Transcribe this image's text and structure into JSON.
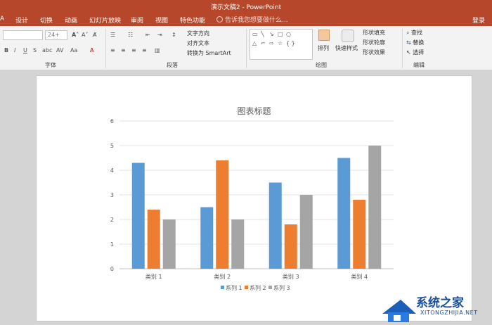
{
  "window": {
    "title": "演示文稿2 - PowerPoint",
    "left_glyph": "A",
    "login_label": "登录"
  },
  "tabs": [
    {
      "label": "设计"
    },
    {
      "label": "切换"
    },
    {
      "label": "动画"
    },
    {
      "label": "幻灯片放映"
    },
    {
      "label": "审阅"
    },
    {
      "label": "视图"
    },
    {
      "label": "特色功能"
    }
  ],
  "tell_me": {
    "placeholder": "告诉我您想要做什么..."
  },
  "ribbon": {
    "font_group_label": "字体",
    "font_size": "24+",
    "paragraph_group_label": "段落",
    "text_direction": "文字方向",
    "align_text": "对齐文本",
    "convert_smartart": "转换为 SmartArt",
    "drawing_group_label": "绘图",
    "arrange_label": "排列",
    "quick_styles_label": "快速样式",
    "shape_fill": "形状填充",
    "shape_outline": "形状轮廓",
    "shape_effects": "形状效果",
    "editing_group_label": "编辑",
    "find": "查找",
    "replace": "替换",
    "select": "选择"
  },
  "watermark": {
    "name": "系统之家",
    "url": "XITONGZHIJIA.NET"
  },
  "chart_data": {
    "type": "bar",
    "title": "图表标题",
    "categories": [
      "类别 1",
      "类别 2",
      "类别 3",
      "类别 4"
    ],
    "series": [
      {
        "name": "系列 1",
        "values": [
          4.3,
          2.5,
          3.5,
          4.5
        ],
        "color": "#5b9bd5"
      },
      {
        "name": "系列 2",
        "values": [
          2.4,
          4.4,
          1.8,
          2.8
        ],
        "color": "#ed7d31"
      },
      {
        "name": "系列 3",
        "values": [
          2,
          2,
          3,
          5
        ],
        "color": "#a5a5a5"
      }
    ],
    "yticks": [
      "0",
      "1",
      "2",
      "3",
      "4",
      "5",
      "6"
    ],
    "ylim": [
      0,
      6
    ],
    "grid": true,
    "legend": "bottom"
  }
}
